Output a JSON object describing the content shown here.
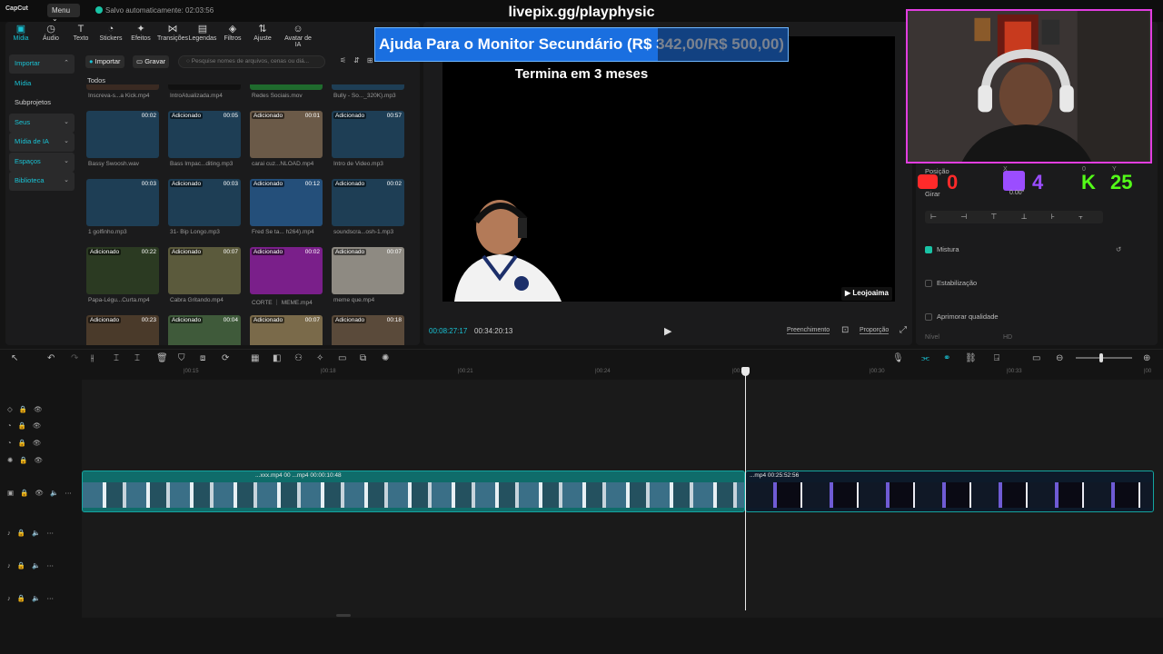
{
  "topbar": {
    "logo": "CapCut",
    "menu": "Menu",
    "autosave": "Salvo automaticamente: 02:03:56",
    "stream_url": "livepix.gg/playphysic"
  },
  "toolbar": [
    {
      "label": "Mídia",
      "icon": "media-icon",
      "glyph": "▣"
    },
    {
      "label": "Áudio",
      "icon": "audio-icon",
      "glyph": "◷"
    },
    {
      "label": "Texto",
      "icon": "text-icon",
      "glyph": "T"
    },
    {
      "label": "Stickers",
      "icon": "sticker-icon",
      "glyph": "◔"
    },
    {
      "label": "Efeitos",
      "icon": "effects-icon",
      "glyph": "✦"
    },
    {
      "label": "Transições",
      "icon": "transitions-icon",
      "glyph": "⋈"
    },
    {
      "label": "Legendas",
      "icon": "captions-icon",
      "glyph": "▤"
    },
    {
      "label": "Filtros",
      "icon": "filters-icon",
      "glyph": "◈"
    },
    {
      "label": "Ajuste",
      "icon": "adjust-icon",
      "glyph": "⇅"
    },
    {
      "label": "Avatar de IA",
      "icon": "ai-avatar-icon",
      "glyph": "☺"
    }
  ],
  "sidebar": {
    "items": [
      {
        "label": "Importar",
        "chevron": "⌃",
        "state": "hl"
      },
      {
        "label": "Mídia",
        "chevron": "",
        "state": "sel"
      },
      {
        "label": "Subprojetos",
        "chevron": "",
        "state": ""
      },
      {
        "label": "Seus",
        "chevron": "⌄",
        "state": "hl"
      },
      {
        "label": "Mídia de IA",
        "chevron": "⌄",
        "state": "hl"
      },
      {
        "label": "Espaços",
        "chevron": "⌄",
        "state": "hl"
      },
      {
        "label": "Biblioteca",
        "chevron": "⌄",
        "state": "hl"
      }
    ]
  },
  "media": {
    "import": "Importar",
    "record": "Gravar",
    "search_placeholder": "Pesquise nomes de arquivos, cenas ou diá...",
    "all": "Todos"
  },
  "media_items": [
    {
      "name": "Inscreva-s...a Kick.mp4",
      "badge": "",
      "dur": "",
      "color": "#3a2a22"
    },
    {
      "name": "IntroAtualizada.mp4",
      "badge": "",
      "dur": "",
      "color": "#111"
    },
    {
      "name": "Redes Sociais.mov",
      "badge": "",
      "dur": "",
      "color": "#1f6b2d"
    },
    {
      "name": "Bully - So..._320K).mp3",
      "badge": "",
      "dur": "",
      "color": "#1e3e55"
    },
    {
      "name": "Bassy Swoosh.wav",
      "badge": "",
      "dur": "00:02",
      "color": "#1e3e55"
    },
    {
      "name": "Bass Impac...diting.mp3",
      "badge": "Adicionado",
      "dur": "00:05",
      "color": "#1e3e55"
    },
    {
      "name": "carai cuz...NLOAD.mp4",
      "badge": "Adicionado",
      "dur": "00:01",
      "color": "#6b5a48"
    },
    {
      "name": "Intro de Video.mp3",
      "badge": "Adicionado",
      "dur": "00:57",
      "color": "#1e3e55"
    },
    {
      "name": "1 golfinho.mp3",
      "badge": "",
      "dur": "00:03",
      "color": "#1e3e55"
    },
    {
      "name": "31- Bip Longo.mp3",
      "badge": "Adicionado",
      "dur": "00:03",
      "color": "#1e3e55"
    },
    {
      "name": "Fred Se ta... h264).mp4",
      "badge": "Adicionado",
      "dur": "00:12",
      "color": "#244f7a"
    },
    {
      "name": "soundscra...osh-1.mp3",
      "badge": "Adicionado",
      "dur": "00:02",
      "color": "#1e3e55"
    },
    {
      "name": "Papa-Légu...Curta.mp4",
      "badge": "Adicionado",
      "dur": "00:22",
      "color": "#2b3a22"
    },
    {
      "name": "Cabra Gritando.mp4",
      "badge": "Adicionado",
      "dur": "00:07",
      "color": "#5b5a3c"
    },
    {
      "name": "CORTE ｜ MEME.mp4",
      "badge": "Adicionado",
      "dur": "00:02",
      "color": "#7a1f8a"
    },
    {
      "name": "meme que.mp4",
      "badge": "Adicionado",
      "dur": "00:07",
      "color": "#8e8a82"
    },
    {
      "name": "",
      "badge": "Adicionado",
      "dur": "00:23",
      "color": "#4a3a2a"
    },
    {
      "name": "",
      "badge": "Adicionado",
      "dur": "00:04",
      "color": "#3f5a3a"
    },
    {
      "name": "",
      "badge": "Adicionado",
      "dur": "00:07",
      "color": "#7a6a4a"
    },
    {
      "name": "",
      "badge": "Adicionado",
      "dur": "00:18",
      "color": "#5a4a3a"
    }
  ],
  "player": {
    "goal_text": "Ajuda Para o Monitor Secundário (R$ 342,00/R$ 500,00)",
    "goal_progress": 0.684,
    "goal_sub": "Termina em 3 meses",
    "channel": "Leojoaima",
    "time_current": "00:08:27:17",
    "time_total": "00:34:20:13",
    "fill": "Preenchimento",
    "ratio": "Proporção"
  },
  "right_panel": {
    "position": "Posição",
    "rotate": "Girar",
    "rotate_value": "0.00°",
    "mix": "Mistura",
    "stabilize": "Estabilização",
    "enhance": "Aprimorar qualidade",
    "level": "Nível",
    "level_value": "HD",
    "x_label": "X",
    "y_label": "Y",
    "x_value": "0",
    "y_value": "0"
  },
  "overlay": {
    "yt": "0",
    "tw": "4",
    "kick": "25"
  },
  "ruler": [
    "|00:15",
    "|00:18",
    "|00:21",
    "|00:24",
    "|00:27",
    "|00:30",
    "|00:33",
    "|00"
  ],
  "clips": [
    {
      "name": "...xxx.mp4  00  ...mp4  00:00:10:48"
    },
    {
      "name": "...mp4  00:25:52:56"
    }
  ]
}
